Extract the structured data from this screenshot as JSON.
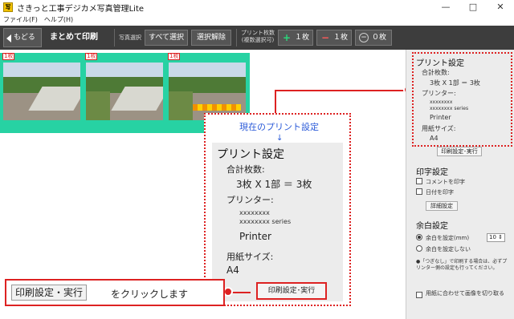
{
  "app": {
    "icon_text": "写",
    "title": "さきっと工事デジカメ写真管理Lite"
  },
  "window_controls": {
    "minimize": "—",
    "maximize": "□",
    "close": "✕"
  },
  "menu": [
    "ファイル(F)",
    "ヘルプ(H)"
  ],
  "toolbar": {
    "back": "もどる",
    "title": "まとめて印刷",
    "select_label": "写真選択",
    "select_all": "すべて選択",
    "select_clear": "選択解除",
    "copies_label_1": "プリント枚数",
    "copies_label_2": "(複数選択可)",
    "plus_one": "１枚",
    "minus_one": "１枚",
    "zero": "０枚"
  },
  "thumbnails": [
    {
      "badge": "1枚",
      "scene": "road-curb"
    },
    {
      "badge": "1枚",
      "scene": "road-wall"
    },
    {
      "badge": "1枚",
      "scene": "road-cones"
    }
  ],
  "callout": {
    "caption": "現在のプリント設定",
    "arrow": "↓",
    "title": "プリント設定",
    "total_label": "合計枚数:",
    "total_value": "3枚 X 1部 ＝ 3枚",
    "printer_label": "プリンター:",
    "printer_line1": "xxxxxxxx",
    "printer_line2": "xxxxxxxx series",
    "printer_name": "Printer",
    "paper_label": "用紙サイズ:",
    "paper_value": "A4",
    "button": "印刷設定･実行"
  },
  "instruction": {
    "key": "印刷設定・実行",
    "text": "をクリックします"
  },
  "right_panel": {
    "print_settings": {
      "title": "プリント設定",
      "total_label": "合計枚数:",
      "total_value": "3枚 X 1部 ＝ 3枚",
      "printer_label": "プリンター:",
      "printer_line1": "xxxxxxxx",
      "printer_line2": "xxxxxxxx series",
      "printer_name": "Printer",
      "paper_label": "用紙サイズ:",
      "paper_value": "A4",
      "button": "印刷設定･実行"
    },
    "print_text": {
      "title": "印字設定",
      "comment": "コメントを印字",
      "date": "日付を印字",
      "detail_button": "詳細設定"
    },
    "margin": {
      "title": "余白設定",
      "set_margin": "余白を設定(mm)",
      "margin_value": "10",
      "no_margin": "余白を設定しない",
      "note": "●「つぎなし」で印刷する場合は、必ずプリンター側の設定も行ってください。",
      "fit_paper": "用紙に合わせて画像を切り取る"
    }
  }
}
